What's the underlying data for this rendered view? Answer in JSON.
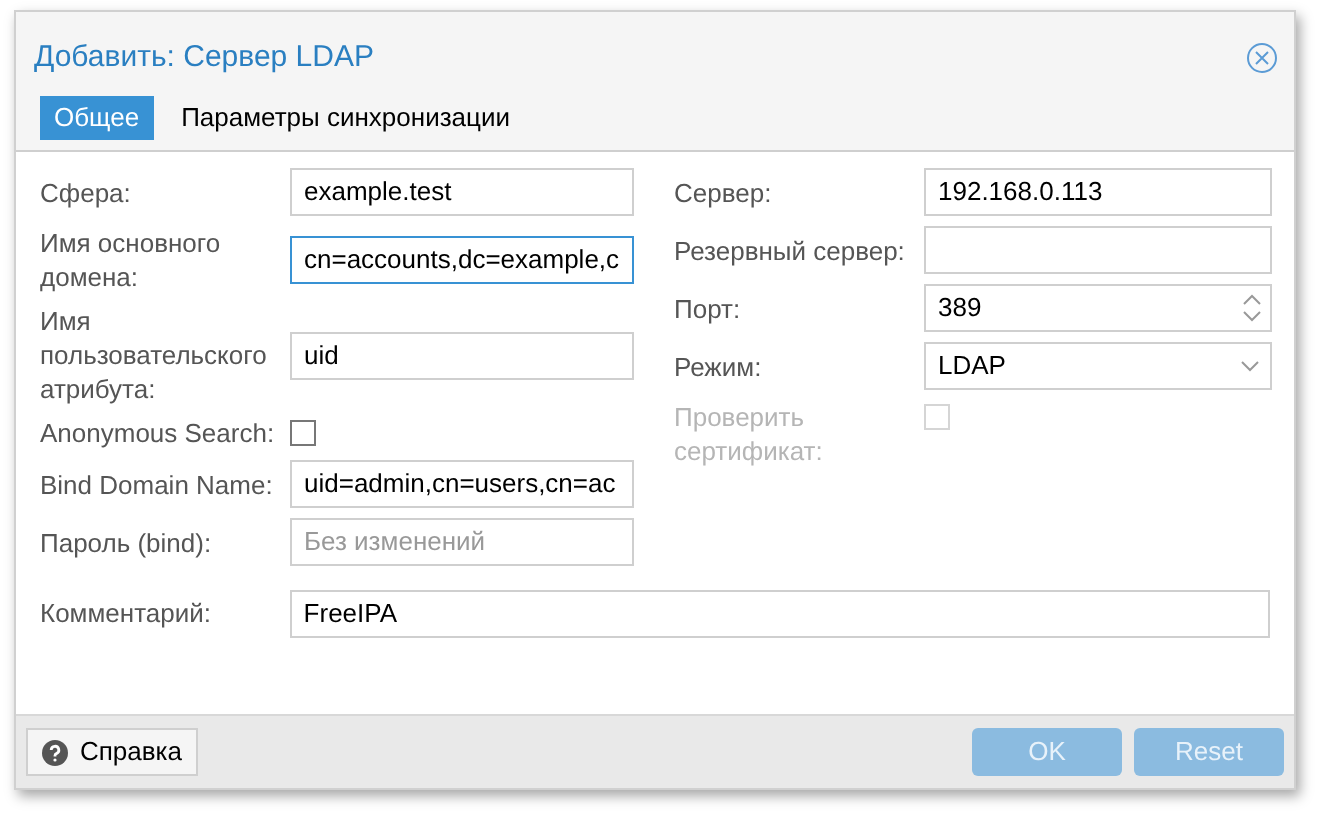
{
  "window": {
    "title": "Добавить: Сервер LDAP"
  },
  "tabs": [
    {
      "label": "Общее",
      "selected": true
    },
    {
      "label": "Параметры синхронизации",
      "selected": false
    }
  ],
  "left_fields": [
    {
      "kind": "text",
      "label": "Сфера:",
      "value": "example.test",
      "focused": false
    },
    {
      "kind": "text",
      "label": "Имя основного домена:",
      "value": "cn=accounts,dc=example,c",
      "focused": true
    },
    {
      "kind": "text",
      "label": "Имя пользовательского атрибута:",
      "value": "uid",
      "focused": false
    },
    {
      "kind": "checkbox",
      "label": "Anonymous Search:",
      "checked": false,
      "disabled": false
    },
    {
      "kind": "text",
      "label": "Bind Domain Name:",
      "value": "uid=admin,cn=users,cn=ac",
      "focused": false
    },
    {
      "kind": "text",
      "label": "Пароль (bind):",
      "placeholder": "Без изменений",
      "focused": false
    }
  ],
  "right_fields": [
    {
      "kind": "text",
      "label": "Сервер:",
      "value": "192.168.0.113",
      "focused": false
    },
    {
      "kind": "text",
      "label": "Резервный сервер:",
      "focused": false
    },
    {
      "kind": "spinner",
      "label": "Порт:",
      "value": "389"
    },
    {
      "kind": "combo",
      "label": "Режим:",
      "value": "LDAP"
    },
    {
      "kind": "checkbox",
      "label": "Проверить сертификат:",
      "checked": false,
      "disabled": true
    }
  ],
  "comment": {
    "label": "Комментарий:",
    "value": "FreeIPA"
  },
  "buttons": [
    {
      "kind": "help",
      "label": "Справка",
      "disabled": false
    },
    {
      "kind": "primary",
      "label": "OK",
      "disabled": true
    },
    {
      "kind": "primary",
      "label": "Reset",
      "disabled": true
    }
  ]
}
